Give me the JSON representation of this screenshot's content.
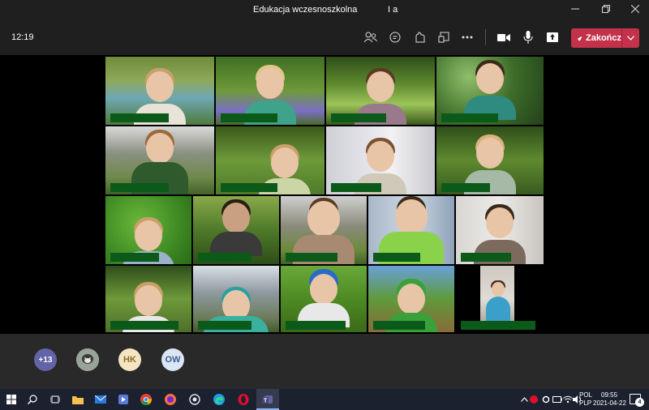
{
  "window": {
    "title": "Edukacja wczesnoszkolna",
    "subtitle": "I a",
    "minimize_icon": "minimize-icon",
    "restore_icon": "restore-icon",
    "close_icon": "close-icon"
  },
  "toolbar": {
    "clock": "12:19",
    "buttons": [
      "participants-icon",
      "chat-icon",
      "reactions-icon",
      "share-tray-icon",
      "more-icon",
      "camera-icon",
      "microphone-icon",
      "share-icon"
    ],
    "end_label": "Zakończ",
    "end_color": "#c4314b"
  },
  "tray": {
    "more_count": "+13",
    "avatar_1": "HK",
    "avatar_2": "OW"
  },
  "taskbar": {
    "lang_1": "POL",
    "lang_2": "PLP",
    "time": "09:55",
    "date": "2021-04-22",
    "notifications": "4",
    "accent": "#8ab4f8"
  }
}
